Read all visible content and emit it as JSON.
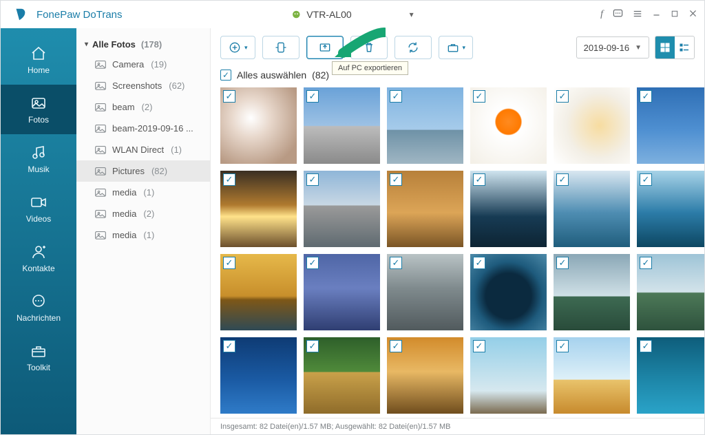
{
  "app": {
    "title": "FonePaw DoTrans"
  },
  "device": {
    "name": "VTR-AL00"
  },
  "nav": [
    {
      "key": "home",
      "label": "Home"
    },
    {
      "key": "fotos",
      "label": "Fotos"
    },
    {
      "key": "musik",
      "label": "Musik"
    },
    {
      "key": "videos",
      "label": "Videos"
    },
    {
      "key": "kontakte",
      "label": "Kontakte"
    },
    {
      "key": "nachrichten",
      "label": "Nachrichten"
    },
    {
      "key": "toolkit",
      "label": "Toolkit"
    }
  ],
  "nav_active": "fotos",
  "tree": {
    "root_label": "Alle Fotos",
    "root_count": "(178)",
    "items": [
      {
        "label": "Camera",
        "count": "(19)"
      },
      {
        "label": "Screenshots",
        "count": "(62)"
      },
      {
        "label": "beam",
        "count": "(2)"
      },
      {
        "label": "beam-2019-09-16 ...",
        "count": ""
      },
      {
        "label": "WLAN Direct",
        "count": "(1)"
      },
      {
        "label": "Pictures",
        "count": "(82)",
        "selected": true
      },
      {
        "label": "media",
        "count": "(1)"
      },
      {
        "label": "media",
        "count": "(2)"
      },
      {
        "label": "media",
        "count": "(1)"
      }
    ]
  },
  "toolbar": {
    "tooltip": "Auf PC exportieren",
    "date": "2019-09-16"
  },
  "select_all": {
    "label": "Alles auswählen",
    "count": "(82)"
  },
  "status": "Insgesamt: 82 Datei(en)/1.57 MB; Ausgewählt: 82 Datei(en)/1.57 MB",
  "thumb_count": 24
}
